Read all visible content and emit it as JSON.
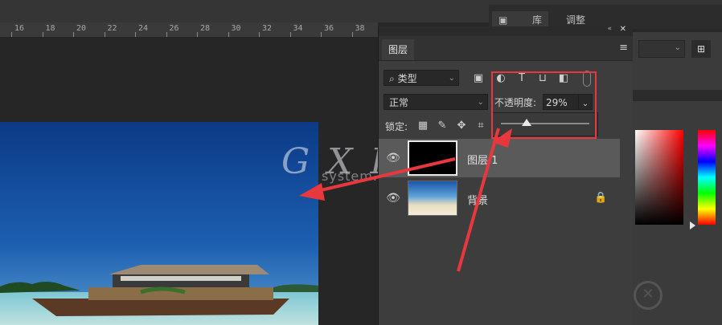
{
  "ruler": {
    "ticks": [
      "16",
      "18",
      "20",
      "22",
      "24",
      "26",
      "28",
      "30",
      "32",
      "34",
      "36",
      "38"
    ]
  },
  "top_tabs": {
    "tab1": "库",
    "tab2": "调整"
  },
  "layers_panel": {
    "title": "图层",
    "filter_kind": "类型",
    "blend_mode": "正常",
    "opacity_label": "不透明度:",
    "opacity_value": "29%",
    "opacity_fraction": 0.29,
    "lock_label": "锁定:",
    "layers": [
      {
        "name": "图层 1",
        "thumb_color": "#000000",
        "selected": true
      },
      {
        "name": "背景",
        "locked": true
      }
    ]
  },
  "watermark": {
    "main": "G X I 网",
    "sub": "system.com"
  },
  "icons": [
    "search-icon",
    "image-filter-icon",
    "adjustment-filter-icon",
    "type-filter-icon",
    "shape-filter-icon",
    "smart-filter-icon",
    "panel-menu-icon",
    "lock-pixels-icon",
    "lock-brush-icon",
    "lock-move-icon",
    "lock-artboard-icon",
    "eye-icon",
    "lock-icon",
    "grid-view-icon"
  ],
  "colors": {
    "annotation_red": "#e8383d",
    "panel_bg": "#3d3d3d",
    "canvas_bg": "#262626"
  }
}
